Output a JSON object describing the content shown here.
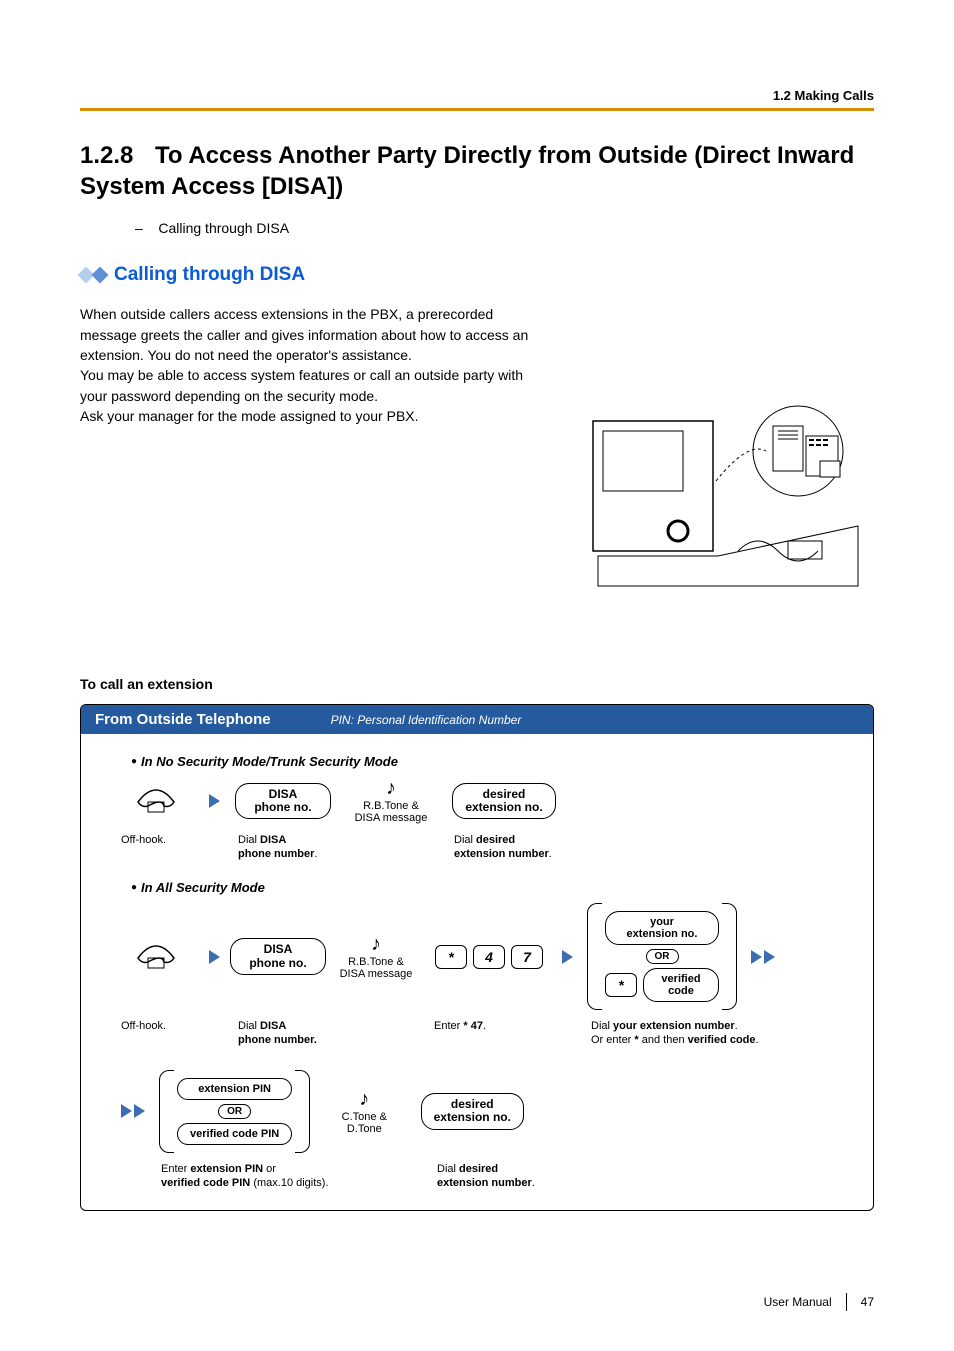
{
  "header": {
    "breadcrumb": "1.2 Making Calls"
  },
  "title": {
    "number": "1.2.8",
    "text": "To Access Another Party Directly from Outside (Direct Inward System Access [DISA])"
  },
  "toc_item": "Calling through DISA",
  "subheading": "Calling through DISA",
  "paragraph1": "When outside callers access extensions in the PBX, a prerecorded message greets the caller and gives information about how to access an extension. You do not need the operator's assistance.",
  "paragraph2": "You may be able to access system features or call an outside party with your password depending on the security mode.",
  "paragraph3": "Ask your manager for the mode assigned to your PBX.",
  "section_label": "To call an extension",
  "flow": {
    "title_left": "From Outside Telephone",
    "title_right": "PIN: Personal Identification Number",
    "mode1": {
      "label": "In No Security Mode/Trunk Security Mode",
      "offhook": "Off-hook.",
      "box1": "DISA\nphone no.",
      "cap1a": "Dial",
      "cap1b": "DISA",
      "cap1c": "phone number",
      "tone_label": "R.B.Tone &\nDISA message",
      "box2": "desired\nextension no.",
      "cap2a": "Dial",
      "cap2b": "desired",
      "cap2c": "extension number"
    },
    "mode2": {
      "label": "In All Security Mode",
      "offhook": "Off-hook.",
      "box1": "DISA\nphone no.",
      "cap1a": "Dial",
      "cap1b": "DISA",
      "cap1c": "phone number.",
      "tone_label": "R.B.Tone &\nDISA message",
      "keys": [
        "*",
        "4",
        "7"
      ],
      "enter_label_a": "Enter",
      "enter_label_b": "47",
      "group_top": "your\nextension no.",
      "or": "OR",
      "group_star_key": "*",
      "group_bottom": "verified\ncode",
      "cap3a": "Dial",
      "cap3b": "your extension number",
      "cap3c": "Or enter",
      "cap3d": "and then",
      "cap3e": "verified code",
      "row3_group_top": "extension PIN",
      "row3_or": "OR",
      "row3_group_bottom": "verified code PIN",
      "row3_cap_a": "Enter",
      "row3_cap_b": "extension PIN",
      "row3_cap_c": "or",
      "row3_cap_d": "verified code PIN",
      "row3_cap_e": "(max.10 digits).",
      "tone2_label": "C.Tone &\nD.Tone",
      "box_last": "desired\nextension no.",
      "cap4a": "Dial",
      "cap4b": "desired",
      "cap4c": "extension number"
    }
  },
  "footer": {
    "manual": "User Manual",
    "page": "47"
  }
}
